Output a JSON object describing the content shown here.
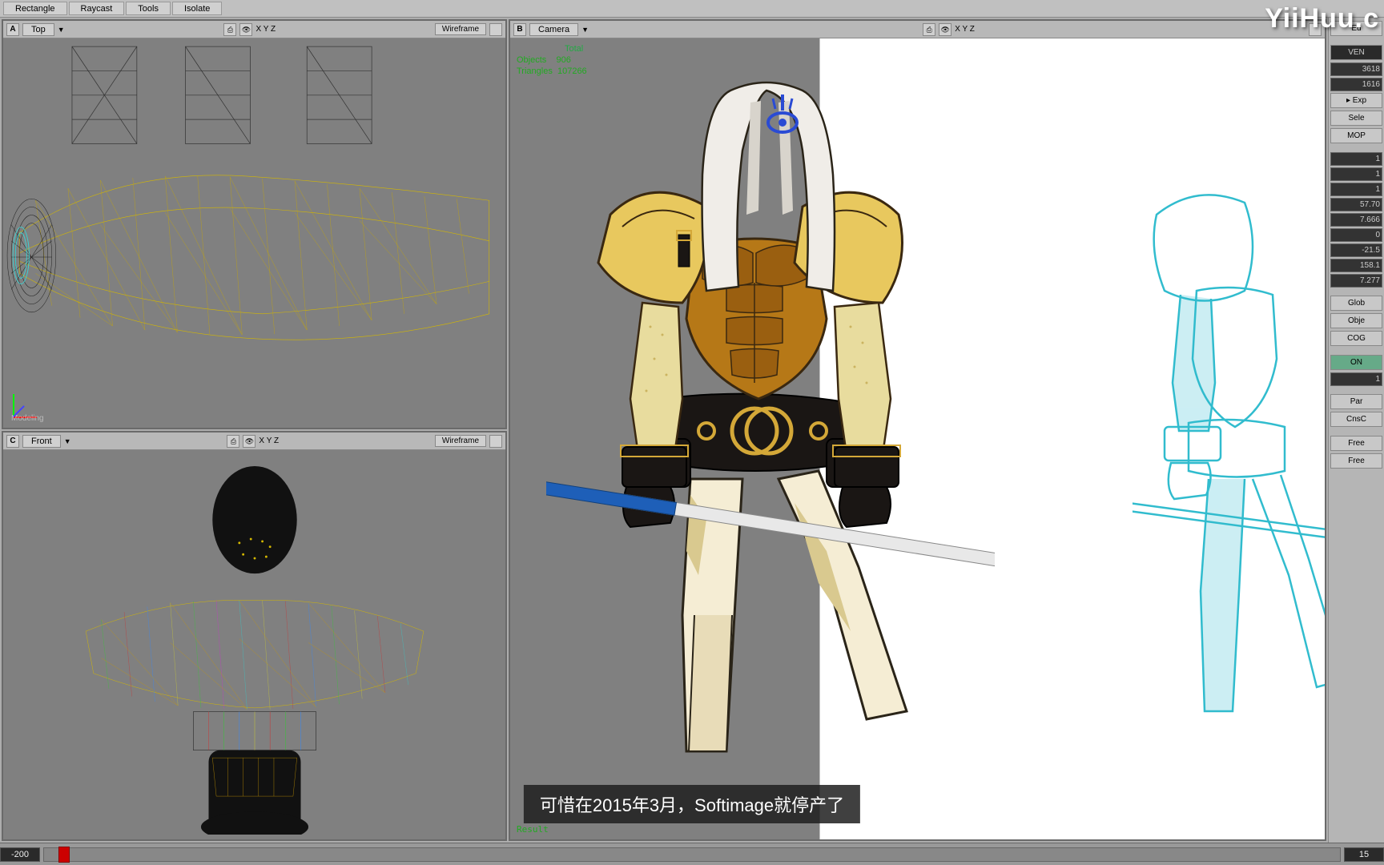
{
  "topbar": {
    "rectangle": "Rectangle",
    "raycast": "Raycast",
    "tools": "Tools",
    "isolate": "Isolate"
  },
  "viewports": {
    "a": {
      "badge": "A",
      "label": "Top",
      "xyz": "X Y Z",
      "mode": "Wireframe",
      "axis_mode": "Modeling"
    },
    "b": {
      "badge": "B",
      "label": "Camera",
      "xyz": "X Y Z",
      "mode": ""
    },
    "c": {
      "badge": "C",
      "label": "Front",
      "xyz": "X Y Z",
      "mode": "Wireframe"
    }
  },
  "stats": {
    "title": "Total",
    "objects_label": "Objects",
    "objects": "906",
    "triangles_label": "Triangles",
    "triangles": "107266",
    "result": "Result"
  },
  "side": {
    "edit": "Ed",
    "ven": "VEN",
    "val1": "3618",
    "val2": "1616",
    "exp": "▸ Exp",
    "sele": "Sele",
    "num1": "1",
    "num2": "1",
    "num3": "1",
    "num4": "57.70",
    "num5": "7.666",
    "num6": "0",
    "num7": "-21.5",
    "num8": "158.1",
    "num9": "7.277",
    "glob": "Glob",
    "obje": "Obje",
    "cog": "COG",
    "on": "ON",
    "off": "1",
    "par": "Par",
    "cnst": "CnsC",
    "free1": "Free",
    "free2": "Free",
    "mop": "MOP"
  },
  "timeline": {
    "start": "-200",
    "end": "15"
  },
  "subtitle": "可惜在2015年3月，Softimage就停产了",
  "watermark": "YiiHuu.c"
}
